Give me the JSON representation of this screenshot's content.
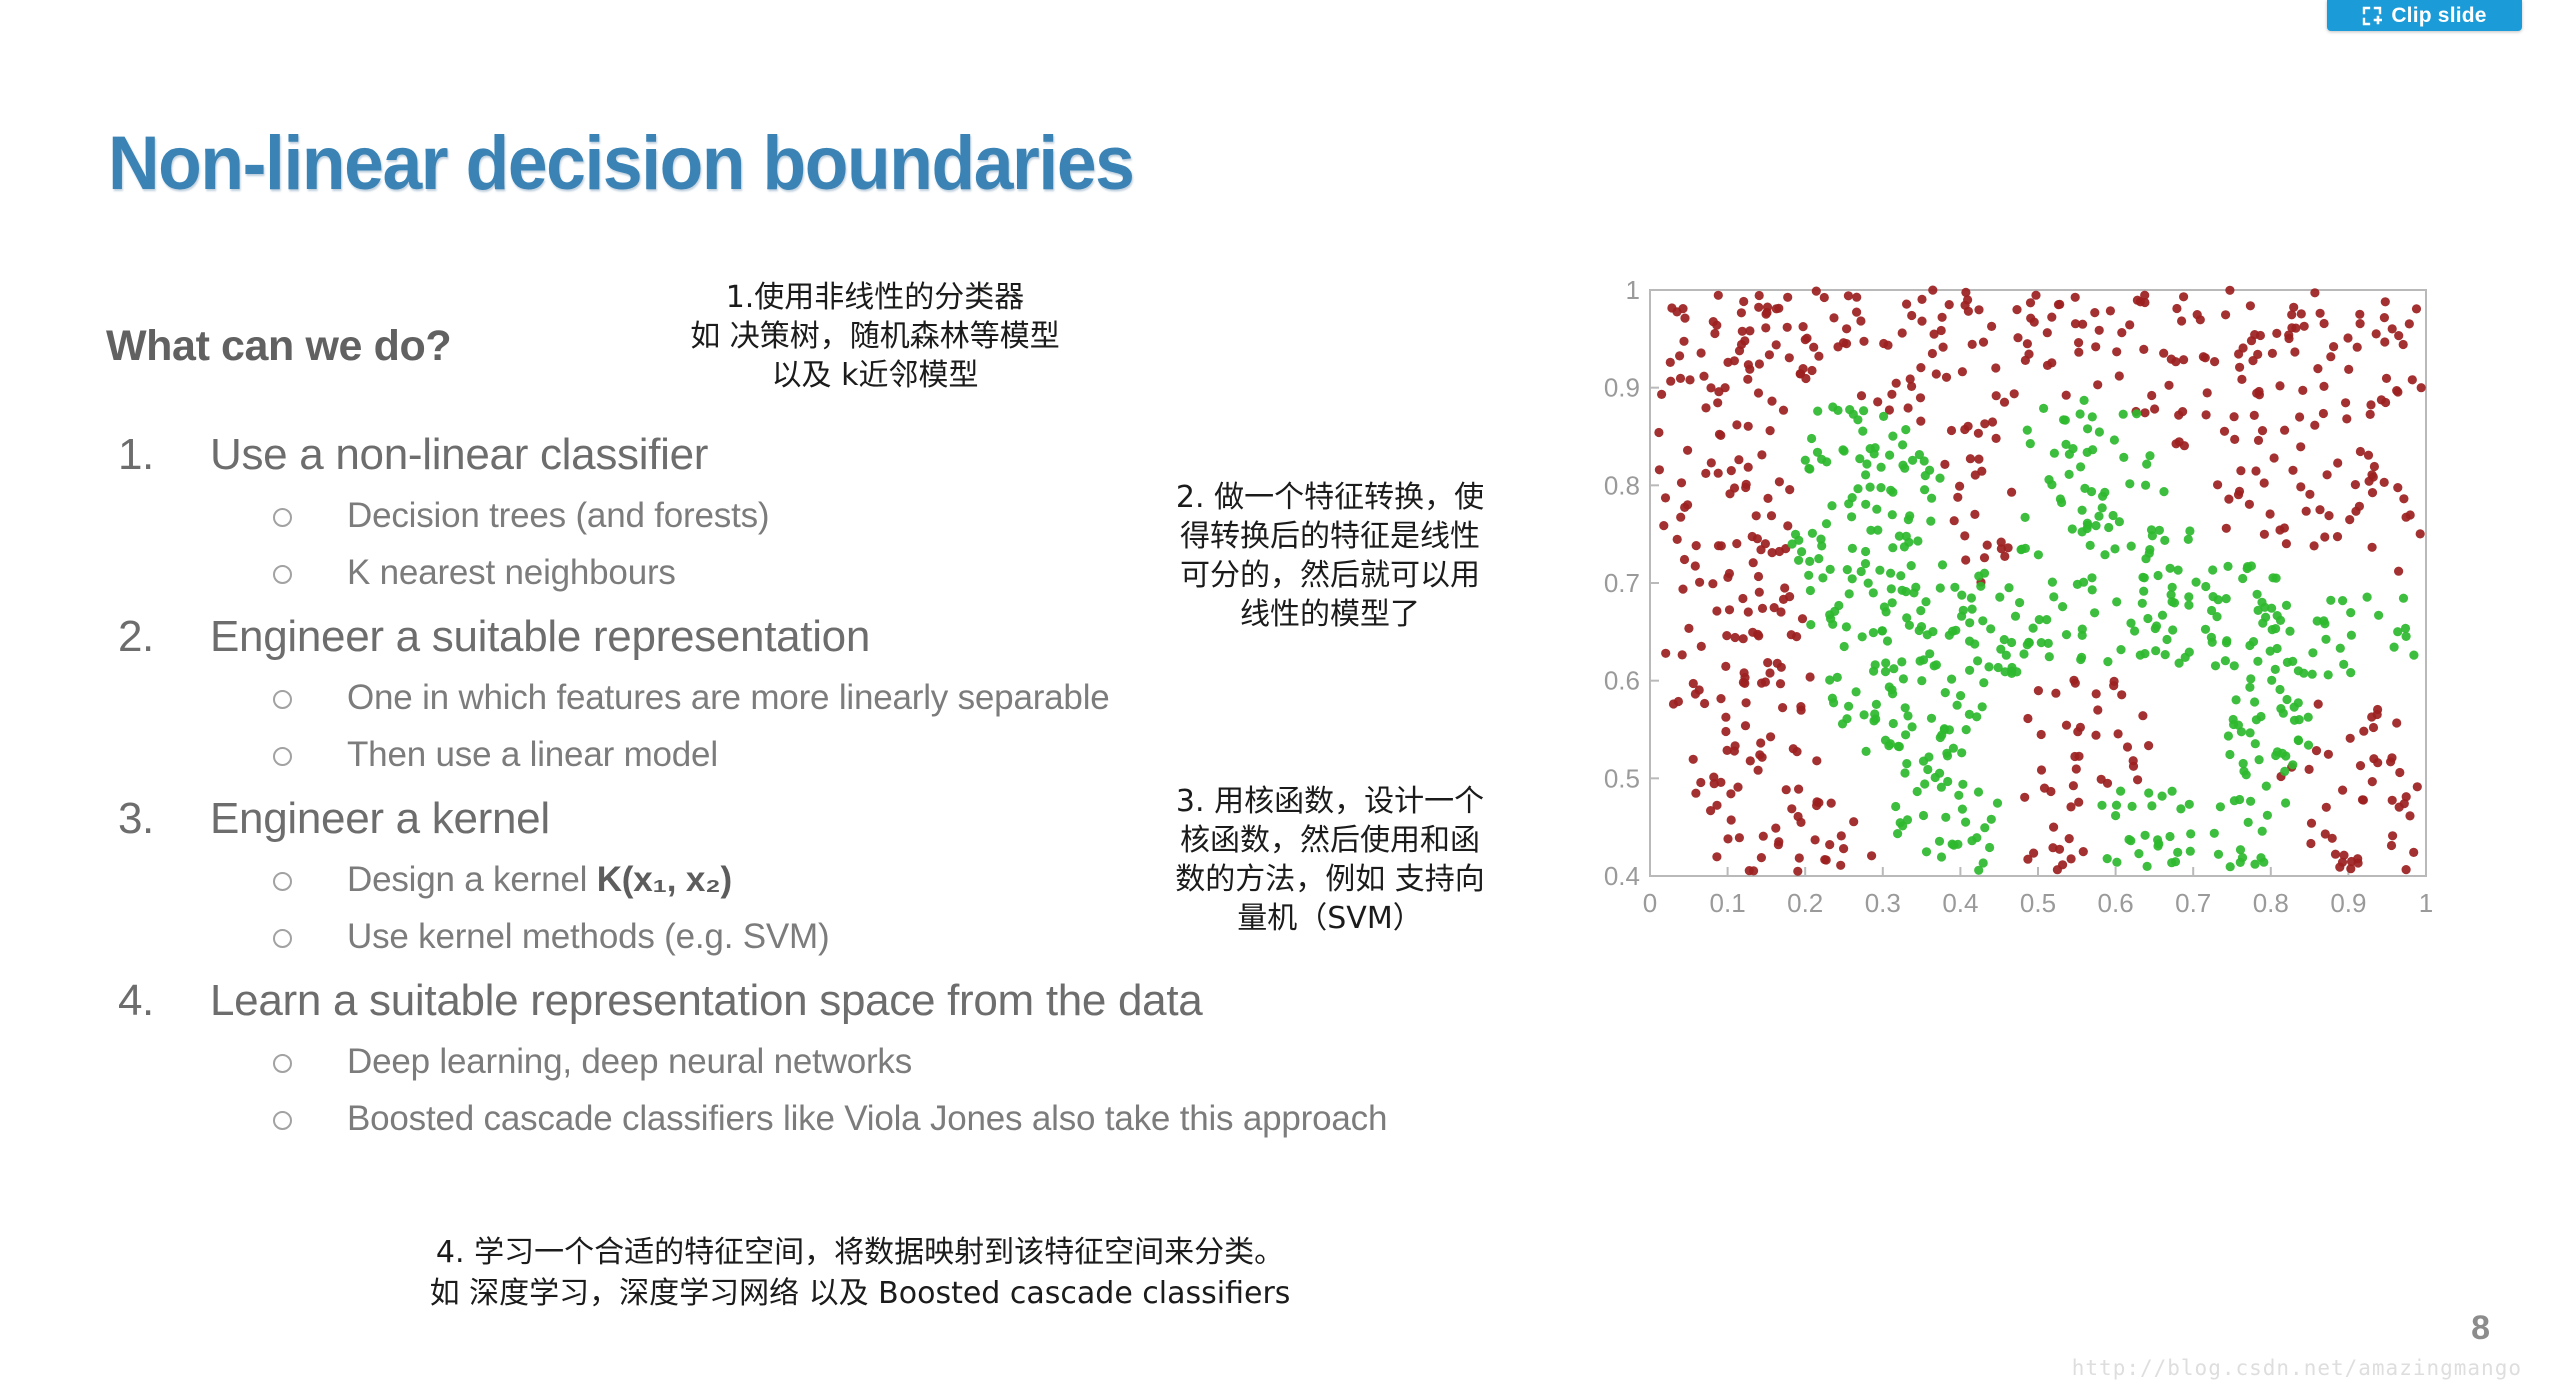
{
  "toolbar": {
    "clip_slide_label": "Clip slide",
    "clip_icon": "clip-slide-icon",
    "accent_color": "#1b9bd8"
  },
  "slide": {
    "title": "Non-linear decision boundaries",
    "title_color": "#3b83b5",
    "section_heading": "What can we do?",
    "page_number": "8",
    "watermark": "http://blog.csdn.net/amazingmango"
  },
  "bullets": [
    {
      "number": "1.",
      "text": "Use a non-linear classifier",
      "subs": [
        {
          "text": "Decision trees (and forests)"
        },
        {
          "text": "K nearest neighbours"
        }
      ]
    },
    {
      "number": "2.",
      "text": "Engineer a suitable representation",
      "subs": [
        {
          "text": "One in which features are more linearly separable"
        },
        {
          "text": "Then use a linear model"
        }
      ]
    },
    {
      "number": "3.",
      "text": "Engineer a kernel",
      "subs": [
        {
          "text": "Design a kernel K(x1, x2)",
          "prefix": "Design a kernel ",
          "formula": "K(x₁, x₂)"
        },
        {
          "text": "Use kernel methods (e.g. SVM)"
        }
      ]
    },
    {
      "number": "4.",
      "text": "Learn a suitable representation space from the data",
      "subs": [
        {
          "text": "Deep learning, deep neural networks"
        },
        {
          "text": "Boosted cascade classifiers like Viola Jones also take this approach"
        }
      ]
    }
  ],
  "annotations": {
    "note1": "1.使用非线性的分类器\n如 决策树，随机森林等模型\n以及 k近邻模型",
    "note2": "2. 做一个特征转换，使\n得转换后的特征是线性\n可分的，然后就可以用\n线性的模型了",
    "note3": "3. 用核函数，设计一个\n核函数，然后使用和函\n数的方法，例如 支持向\n量机（SVM）",
    "note4": "4. 学习一个合适的特征空间，将数据映射到该特征空间来分类。\n如 深度学习，深度学习网络 以及 Boosted cascade classifiers"
  },
  "chart_data": {
    "type": "scatter",
    "title": "",
    "xlabel": "",
    "ylabel": "",
    "xlim": [
      0,
      1
    ],
    "ylim": [
      0.4,
      1
    ],
    "grid": false,
    "legend": null,
    "x_ticks": [
      "0",
      "0.1",
      "0.2",
      "0.3",
      "0.4",
      "0.5",
      "0.6",
      "0.7",
      "0.8",
      "0.9",
      "1"
    ],
    "y_ticks": [
      "0.4",
      "0.5",
      "0.6",
      "0.7",
      "0.8",
      "0.9",
      "1"
    ],
    "series": [
      {
        "name": "class-red",
        "color": "#9c1f1f",
        "marker": "circle",
        "approx_count": 560,
        "description": "Red points occupy the outer region: a broad band along the top (y>0.85), the left side (x<0.25), a lower-middle cluster near x 0.5-0.65 / y 0.42-0.60, and the lower-right corner (x>0.85, y<0.60)."
      },
      {
        "name": "class-green",
        "color": "#2eb82e",
        "marker": "circle",
        "approx_count": 520,
        "description": "Green points form an irregular non-linearly-separable blob through the middle: x 0.2-0.45 band descending from y 0.87 to y 0.40, a second lobe x 0.5-0.72 around y 0.5-0.9, joined by a horizontal arm near y 0.62-0.70 extending right to x 0.98."
      }
    ],
    "note": "Two interleaved classes that cannot be separated by a straight line."
  }
}
